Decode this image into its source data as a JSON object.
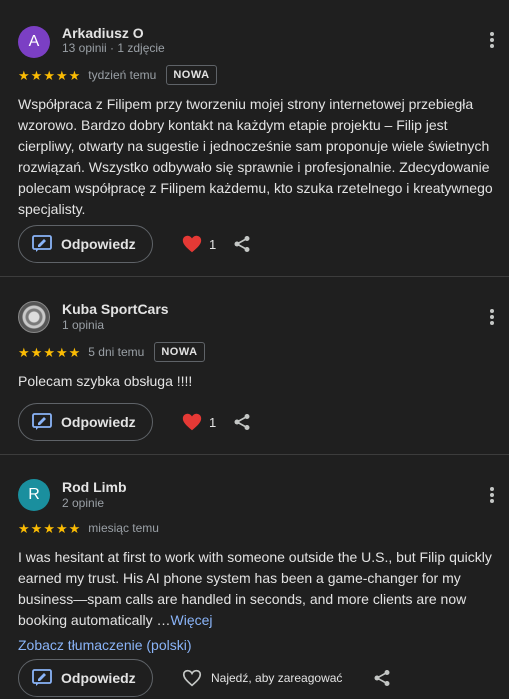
{
  "reviews": [
    {
      "avatar_letter": "A",
      "name": "Arkadiusz O",
      "meta": "13 opinii · 1 zdjęcie",
      "stars": 5,
      "when": "tydzień temu",
      "badge": "NOWA",
      "text": "Współpraca z Filipem przy tworzeniu mojej strony internetowej przebiegła wzorowo. Bardzo dobry kontakt na każdym etapie projektu – Filip jest cierpliwy, otwarty na sugestie i jednocześnie sam proponuje wiele świetnych rozwiązań. Wszystko odbywało się sprawnie i profesjonalnie. Zdecydowanie polecam współpracę z Filipem każdemu, kto szuka rzetelnego i kreatywnego specjalisty.",
      "reply_label": "Odpowiedz",
      "reaction_count": "1"
    },
    {
      "name": "Kuba SportCars",
      "meta": "1 opinia",
      "stars": 5,
      "when": "5 dni temu",
      "badge": "NOWA",
      "text": "Polecam szybka obsługa !!!!",
      "reply_label": "Odpowiedz",
      "reaction_count": "1"
    },
    {
      "avatar_letter": "R",
      "name": "Rod Limb",
      "meta": "2 opinie",
      "stars": 5,
      "when": "miesiąc temu",
      "text": "I was hesitant at first to work with someone outside the U.S., but Filip quickly earned my trust. His AI phone system has been a game-changer for my business—spam calls are handled in seconds, and more clients are now booking automatically …",
      "more_label": "Więcej",
      "translate_label": "Zobacz tłumaczenie (polski)",
      "reply_label": "Odpowiedz",
      "react_hint": "Najedź, aby zareagować"
    }
  ],
  "colors": {
    "background": "#1f1f1f",
    "star": "#fbbc04",
    "link": "#8ab4f8",
    "heart": "#e53935"
  },
  "icons": [
    "more-vert-icon",
    "star-icon",
    "reply-icon",
    "heart-icon",
    "heart-outline-icon",
    "share-icon"
  ]
}
